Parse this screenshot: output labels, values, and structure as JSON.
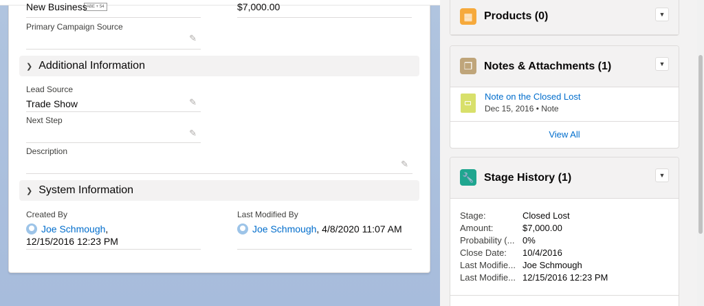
{
  "header_tag": "ABE + 54",
  "top_fields": {
    "left_value": "New Business",
    "right_value": "$7,000.00"
  },
  "primary_campaign": {
    "label": "Primary Campaign Source",
    "value": ""
  },
  "sections": {
    "additional": "Additional Information",
    "system": "System Information"
  },
  "additional": {
    "lead_source": {
      "label": "Lead Source",
      "value": "Trade Show"
    },
    "next_step": {
      "label": "Next Step",
      "value": ""
    },
    "description": {
      "label": "Description",
      "value": ""
    }
  },
  "system": {
    "created_by": {
      "label": "Created By",
      "user": "Joe Schmough",
      "comma": ",",
      "date": "12/15/2016 12:23 PM"
    },
    "last_modified_by": {
      "label": "Last Modified By",
      "user": "Joe Schmough",
      "date": ", 4/8/2020 11:07 AM"
    }
  },
  "products": {
    "title": "Products (0)"
  },
  "notes": {
    "title": "Notes & Attachments (1)",
    "item_title": "Note on the Closed Lost",
    "item_meta": "Dec 15, 2016 • Note",
    "view_all": "View All"
  },
  "stage_history": {
    "title": "Stage History (1)",
    "rows": [
      {
        "k": "Stage:",
        "v": "Closed Lost"
      },
      {
        "k": "Amount:",
        "v": "$7,000.00"
      },
      {
        "k": "Probability (...",
        "v": "0%"
      },
      {
        "k": "Close Date:",
        "v": "10/4/2016"
      },
      {
        "k": "Last Modifie...",
        "v": "Joe Schmough"
      },
      {
        "k": "Last Modifie...",
        "v": "12/15/2016 12:23 PM"
      }
    ]
  },
  "colors": {
    "products_icon": "#f6a93b",
    "notes_icon": "#bfa57a",
    "stage_icon": "#1fa68f",
    "link": "#006dcc",
    "note_file": "#d8e06b"
  },
  "icons": {
    "edit": "pencil-icon",
    "chevron": "chevron-down-icon",
    "products": "products-icon",
    "notes": "notes-icon",
    "stage": "wrench-icon",
    "file": "note-file-icon",
    "avatar": "user-avatar"
  }
}
